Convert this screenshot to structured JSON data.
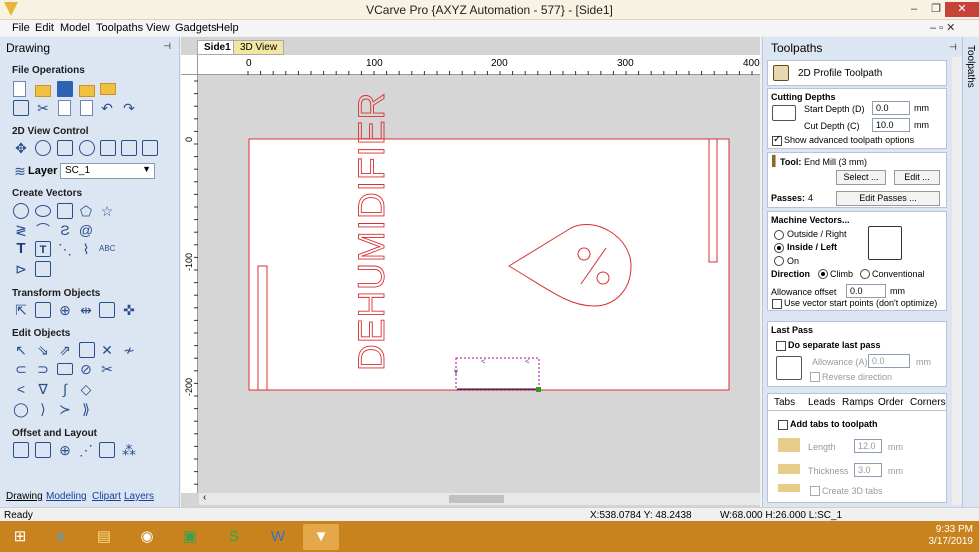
{
  "window": {
    "title": "VCarve Pro {AXYZ Automation - 577} - [Side1]",
    "min": "–",
    "max": "❐",
    "close": "✕"
  },
  "menu": [
    "File",
    "Edit",
    "Model",
    "Toolpaths",
    "View",
    "Gadgets",
    "Help"
  ],
  "menu_mdi": "– ▫ ✕",
  "left_panel": {
    "title": "Drawing",
    "pin": "⊣",
    "sections": [
      "File Operations",
      "2D View Control",
      "Create Vectors",
      "Transform Objects",
      "Edit Objects",
      "Offset and Layout"
    ],
    "layer_label": "Layer",
    "layer_value": "SC_1",
    "tabs": [
      "Drawing",
      "Modeling",
      "Clipart",
      "Layers"
    ]
  },
  "doc_tabs": [
    "Side1",
    "3D View"
  ],
  "ruler": {
    "h_ticks": [
      "0",
      "100",
      "200",
      "300",
      "400"
    ],
    "v_ticks": [
      "0",
      "-100",
      "-200"
    ]
  },
  "design_text": "DEHUMIDIFIER",
  "right_panel": {
    "title": "Toolpaths",
    "strip": "Toolpaths",
    "toolpath_name": "2D Profile Toolpath",
    "cutting_depths": "Cutting Depths",
    "start_depth_label": "Start Depth (D)",
    "start_depth": "0.0",
    "cut_depth_label": "Cut Depth (C)",
    "cut_depth": "10.0",
    "unit": "mm",
    "show_advanced": "Show advanced toolpath options",
    "tool_label": "Tool:",
    "tool_value": "End Mill (3 mm)",
    "select_btn": "Select ...",
    "edit_btn": "Edit ...",
    "passes_label": "Passes:",
    "passes_value": "4",
    "edit_passes_btn": "Edit Passes ...",
    "machine_vectors": "Machine Vectors...",
    "outside_right": "Outside / Right",
    "inside_left": "Inside / Left",
    "on": "On",
    "direction": "Direction",
    "climb": "Climb",
    "conventional": "Conventional",
    "allowance_offset": "Allowance offset",
    "allowance_value": "0.0",
    "vector_start": "Use vector start points (don't optimize)",
    "last_pass": "Last Pass",
    "separate_last_pass": "Do separate last pass",
    "allowance_a": "Allowance (A)",
    "allowance_a_value": "0.0",
    "reverse_direction": "Reverse direction",
    "subtabs": [
      "Tabs",
      "Leads",
      "Ramps",
      "Order",
      "Corners"
    ],
    "add_tabs": "Add tabs to toolpath",
    "length_label": "Length",
    "length_value": "12.0",
    "thickness_label": "Thickness",
    "thickness_value": "3.0",
    "create_3d_tabs": "Create 3D tabs"
  },
  "status": {
    "ready": "Ready",
    "coords": "X:538.0784 Y: 48.2438",
    "size": "W:68.000  H:26.000  L:SC_1"
  },
  "taskbar": {
    "time": "9:33 PM",
    "date": "3/17/2019"
  },
  "colors": {
    "accent": "#d83030",
    "selection": "#b000b0",
    "panel": "#dce6f3",
    "taskbar": "#c8831f"
  }
}
